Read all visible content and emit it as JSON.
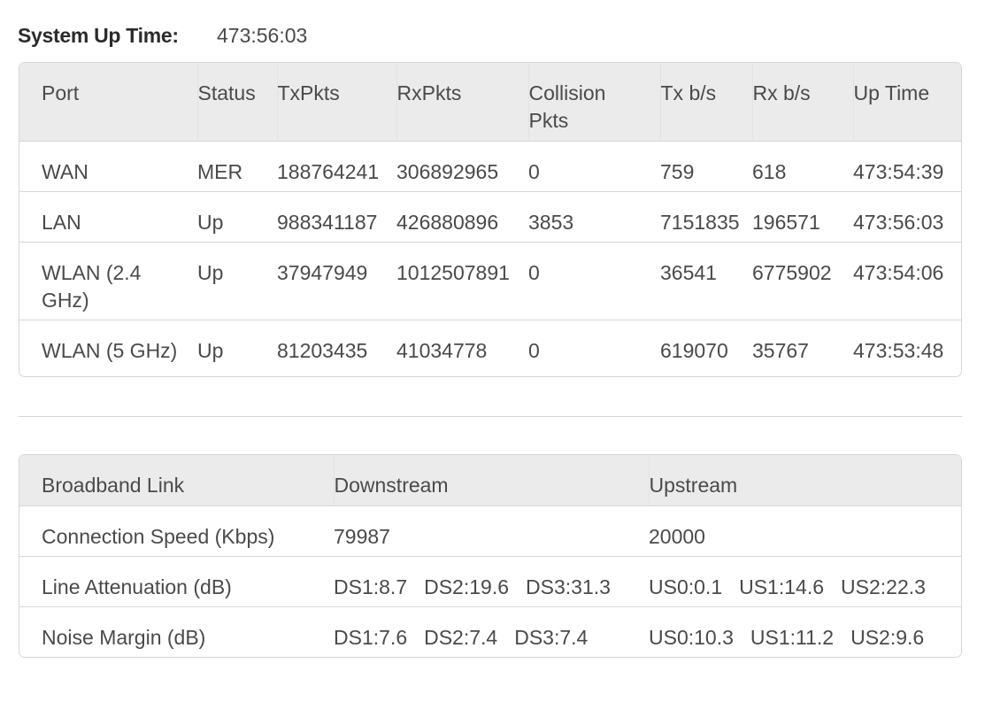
{
  "system_uptime": {
    "label": "System Up Time:",
    "value": "473:56:03"
  },
  "stats_table": {
    "headers": {
      "port": "Port",
      "status": "Status",
      "txpkts": "TxPkts",
      "rxpkts": "RxPkts",
      "collision_line1": "Collision",
      "collision_line2": "Pkts",
      "txbs": "Tx b/s",
      "rxbs": "Rx b/s",
      "uptime": "Up Time"
    },
    "rows": [
      {
        "port": "WAN",
        "status": "MER",
        "txpkts": "188764241",
        "rxpkts": "306892965",
        "collision": "0",
        "txbs": "759",
        "rxbs": "618",
        "uptime": "473:54:39"
      },
      {
        "port": "LAN",
        "status": "Up",
        "txpkts": "988341187",
        "rxpkts": "426880896",
        "collision": "3853",
        "txbs": "7151835",
        "rxbs": "196571",
        "uptime": "473:56:03"
      },
      {
        "port": "WLAN (2.4 GHz)",
        "status": "Up",
        "txpkts": "37947949",
        "rxpkts": "1012507891",
        "collision": "0",
        "txbs": "36541",
        "rxbs": "6775902",
        "uptime": "473:54:06"
      },
      {
        "port": "WLAN (5 GHz)",
        "status": "Up",
        "txpkts": "81203435",
        "rxpkts": "41034778",
        "collision": "0",
        "txbs": "619070",
        "rxbs": "35767",
        "uptime": "473:53:48"
      }
    ]
  },
  "broadband_table": {
    "headers": {
      "link": "Broadband Link",
      "downstream": "Downstream",
      "upstream": "Upstream"
    },
    "rows": [
      {
        "label": "Connection Speed (Kbps)",
        "down": [
          "79987"
        ],
        "up": [
          "20000"
        ]
      },
      {
        "label": "Line Attenuation (dB)",
        "down": [
          "DS1:8.7",
          "DS2:19.6",
          "DS3:31.3"
        ],
        "up": [
          "US0:0.1",
          "US1:14.6",
          "US2:22.3"
        ]
      },
      {
        "label": "Noise Margin (dB)",
        "down": [
          "DS1:7.6",
          "DS2:7.4",
          "DS3:7.4"
        ],
        "up": [
          "US0:10.3",
          "US1:11.2",
          "US2:9.6"
        ]
      }
    ]
  }
}
